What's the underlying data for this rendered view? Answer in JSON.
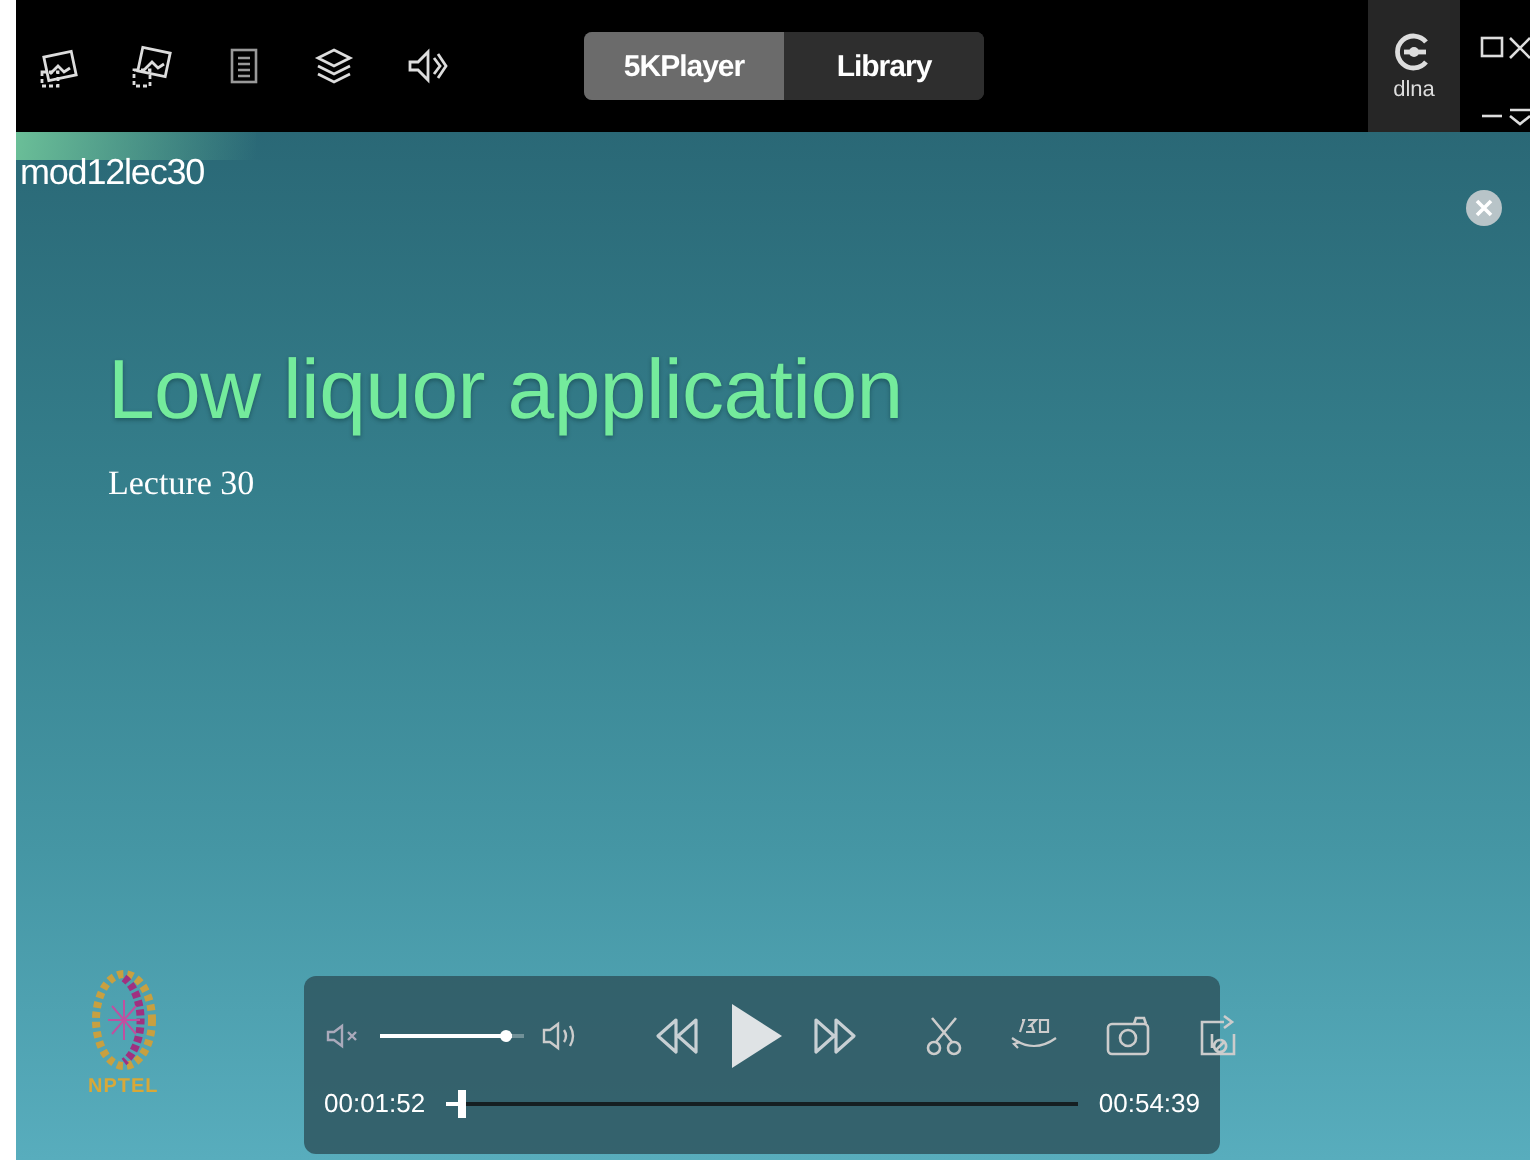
{
  "tabs": [
    {
      "label": "5KPlayer",
      "selected": true
    },
    {
      "label": "Library",
      "selected": false
    }
  ],
  "dlna": {
    "label": "dlna"
  },
  "video": {
    "title": "mod12lec30"
  },
  "slide": {
    "heading": "Low liquor application",
    "subheading": "Lecture 30",
    "logo_text": "NPTEL"
  },
  "controls": {
    "playing": false,
    "volume": {
      "level": 0.92
    },
    "position": {
      "level": 0.034
    },
    "elapsed": "00:01:52",
    "duration": "00:54:39"
  }
}
